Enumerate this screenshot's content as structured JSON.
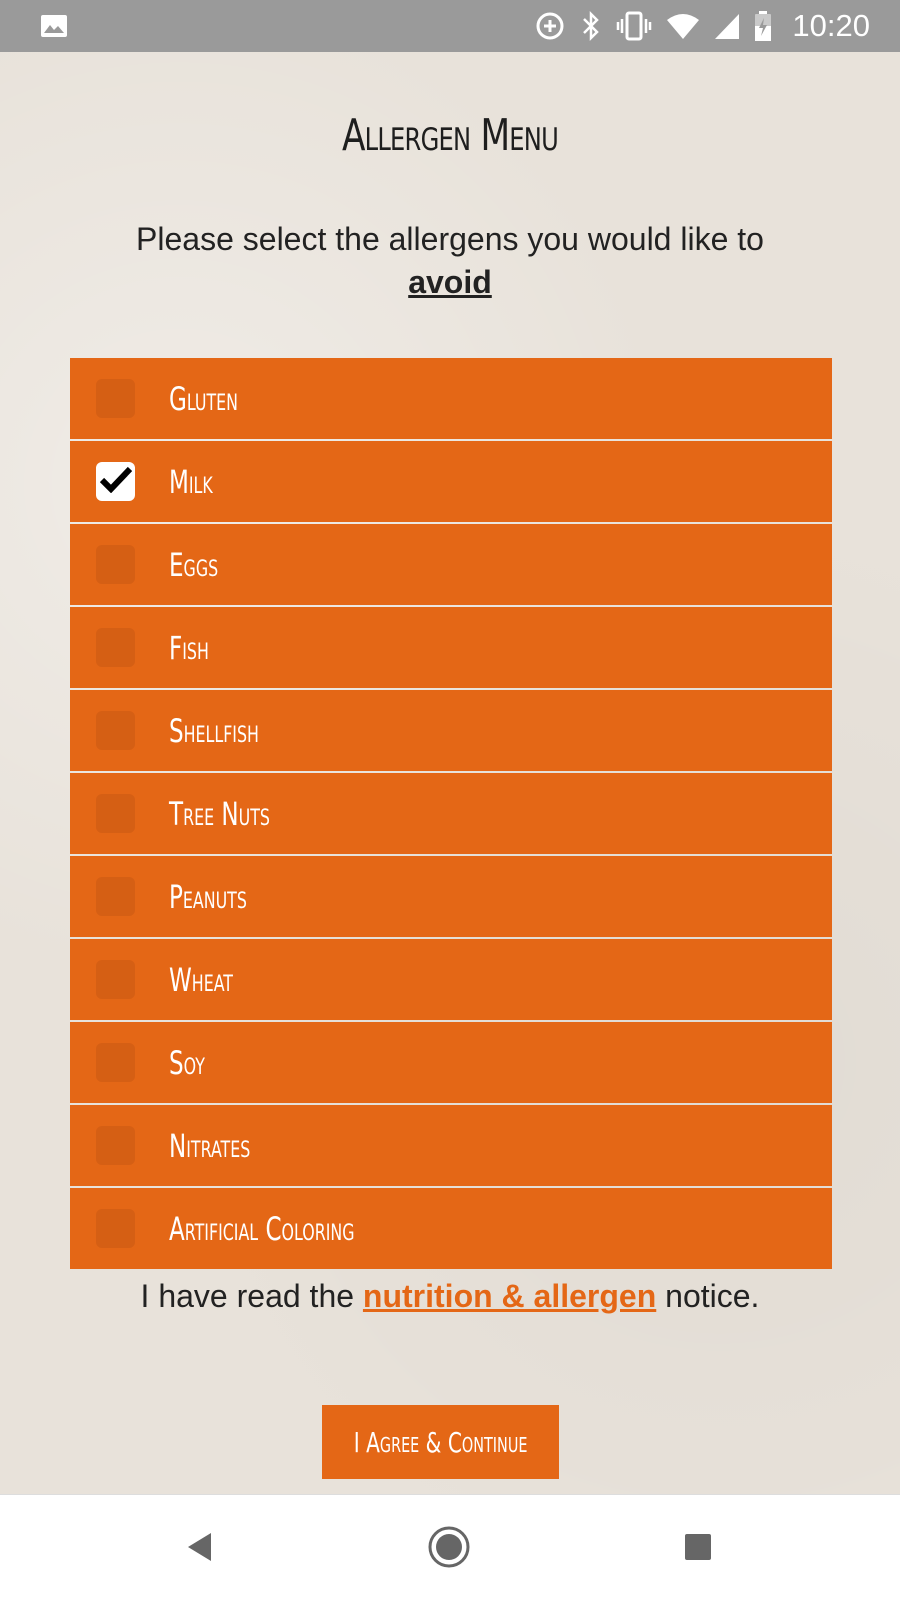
{
  "status_bar": {
    "time": "10:20",
    "icons": [
      "image-icon",
      "data-saver-icon",
      "bluetooth-icon",
      "vibrate-icon",
      "wifi-icon",
      "signal-icon",
      "battery-icon"
    ]
  },
  "page": {
    "title": "Allergen Menu",
    "instruction_text": "Please select the allergens you would like to",
    "instruction_emphasis": "avoid"
  },
  "allergens": [
    {
      "label": "Gluten",
      "checked": false
    },
    {
      "label": "Milk",
      "checked": true
    },
    {
      "label": "Eggs",
      "checked": false
    },
    {
      "label": "Fish",
      "checked": false
    },
    {
      "label": "Shellfish",
      "checked": false
    },
    {
      "label": "Tree Nuts",
      "checked": false
    },
    {
      "label": "Peanuts",
      "checked": false
    },
    {
      "label": "Wheat",
      "checked": false
    },
    {
      "label": "Soy",
      "checked": false
    },
    {
      "label": "Nitrates",
      "checked": false
    },
    {
      "label": "Artificial Coloring",
      "checked": false
    }
  ],
  "notice": {
    "prefix": "I have read the",
    "link_text": "nutrition & allergen",
    "suffix": "notice."
  },
  "agree_button": {
    "label": "I Agree & Continue"
  },
  "colors": {
    "accent": "#e46716",
    "background": "#e8e2da",
    "text": "#222222"
  },
  "nav_bar": {
    "icons": [
      "back-icon",
      "home-icon",
      "recents-icon"
    ]
  }
}
